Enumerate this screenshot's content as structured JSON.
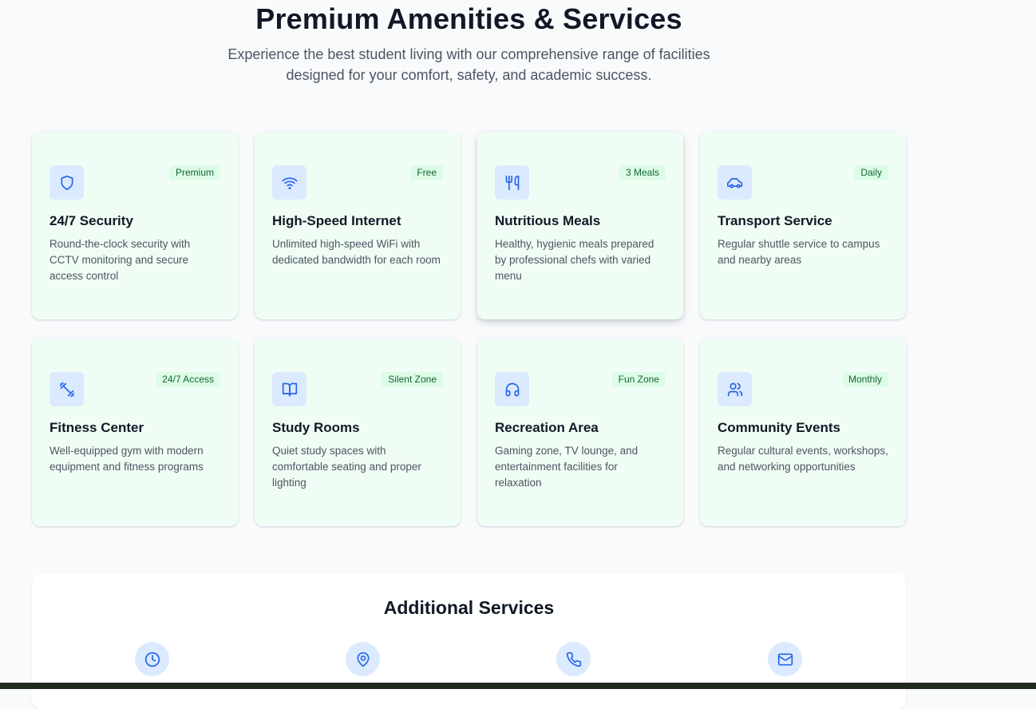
{
  "header": {
    "title": "Premium Amenities & Services",
    "subtitle": "Experience the best student living with our comprehensive range of facilities designed for your comfort, safety, and academic success."
  },
  "amenities": [
    {
      "icon": "shield-icon",
      "badge": "Premium",
      "title": "24/7 Security",
      "description": "Round-the-clock security with CCTV monitoring and secure access control"
    },
    {
      "icon": "wifi-icon",
      "badge": "Free",
      "title": "High-Speed Internet",
      "description": "Unlimited high-speed WiFi with dedicated bandwidth for each room"
    },
    {
      "icon": "utensils-icon",
      "badge": "3 Meals",
      "title": "Nutritious Meals",
      "description": "Healthy, hygienic meals prepared by professional chefs with varied menu"
    },
    {
      "icon": "car-icon",
      "badge": "Daily",
      "title": "Transport Service",
      "description": "Regular shuttle service to campus and nearby areas"
    },
    {
      "icon": "dumbbell-icon",
      "badge": "24/7 Access",
      "title": "Fitness Center",
      "description": "Well-equipped gym with modern equipment and fitness programs"
    },
    {
      "icon": "book-icon",
      "badge": "Silent Zone",
      "title": "Study Rooms",
      "description": "Quiet study spaces with comfortable seating and proper lighting"
    },
    {
      "icon": "headphones-icon",
      "badge": "Fun Zone",
      "title": "Recreation Area",
      "description": "Gaming zone, TV lounge, and entertainment facilities for relaxation"
    },
    {
      "icon": "users-icon",
      "badge": "Monthly",
      "title": "Community Events",
      "description": "Regular cultural events, workshops, and networking opportunities"
    }
  ],
  "additional_services": {
    "title": "Additional Services",
    "icons": [
      "clock-icon",
      "map-pin-icon",
      "phone-icon",
      "mail-icon"
    ]
  },
  "colors": {
    "card_background": "#f0fdf4",
    "icon_background": "#dbeafe",
    "icon_stroke": "#2563eb",
    "badge_background": "#dcfce7",
    "badge_text": "#166534"
  }
}
